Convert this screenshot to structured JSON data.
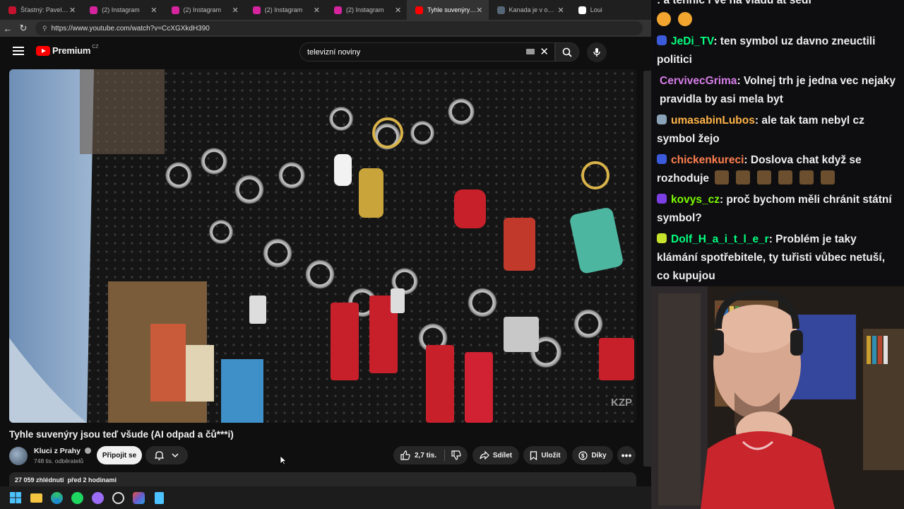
{
  "browser": {
    "tabs": [
      {
        "title": "Šťastný: Pavel je lídr opo",
        "icon": "news-icon",
        "color": "#c4122f",
        "active": false
      },
      {
        "title": "(2) Instagram",
        "icon": "instagram-icon",
        "color": "#d6249f",
        "active": false
      },
      {
        "title": "(2) Instagram",
        "icon": "instagram-icon",
        "color": "#d6249f",
        "active": false
      },
      {
        "title": "(2) Instagram",
        "icon": "instagram-icon",
        "color": "#d6249f",
        "active": false
      },
      {
        "title": "(2) Instagram",
        "icon": "instagram-icon",
        "color": "#d6249f",
        "active": false
      },
      {
        "title": "Tyhle suvenýry jsou",
        "icon": "youtube-icon",
        "color": "#ff0000",
        "active": true
      },
      {
        "title": "Kanada je v obchodní vá",
        "icon": "news-icon",
        "color": "#556677",
        "active": false
      },
      {
        "title": "Loui",
        "icon": "x-icon",
        "color": "#ffffff",
        "active": false
      }
    ],
    "url": "https://www.youtube.com/watch?v=CcXGXkdH390"
  },
  "youtube": {
    "brand": "Premium",
    "region": "CZ",
    "search_value": "televizní noviny",
    "video_watermark": "KZP",
    "title": "Tyhle suvenýry jsou teď všude (AI odpad a čů***i)",
    "channel_name": "Kluci z Prahy",
    "subscribers": "748 tis. odběratelů",
    "join_label": "Připojit se",
    "like_count": "2,7 tis.",
    "share_label": "Sdílet",
    "save_label": "Uložit",
    "thanks_label": "Díky",
    "views": "27 059 zhlédnutí",
    "published": "před 2 hodinami"
  },
  "chat": {
    "messages": [
      {
        "user": "",
        "color": "#9147ff",
        "text": ": a tennic i ve na vladu at sedi",
        "partial": true
      },
      {
        "user": "JeDi_TV",
        "color": "#00ff7f",
        "badge": "#3b5bdb",
        "text": ": ten symbol uz davno zneuctili politici"
      },
      {
        "user": "CervivecGrima",
        "color": "#d67ee8",
        "badge": "",
        "text": ": Volnej trh je jedna vec nejaky pravidla by asi mela byt"
      },
      {
        "user": "umasabinLubos",
        "color": "#ffb347",
        "badge": "#8aa3b8",
        "text": ": ale tak tam nebyl cz symbol žejo"
      },
      {
        "user": "chickenkureci",
        "color": "#ff7f50",
        "badge": "#3b5bdb",
        "text": ": Doslova chat když se rozhoduje"
      },
      {
        "user": "kovys_cz",
        "color": "#7cfc00",
        "badge": "#7b3fe4",
        "text": ": proč bychom měli chránit státní symbol?"
      },
      {
        "user": "Dolf_H_a_i_t_l_e_r",
        "color": "#00ff7f",
        "badge": "#c8e32b",
        "text": ": Problém je taky klámání spotřebitele, ty tuřisti vůbec netuší, co kupujou"
      }
    ]
  }
}
